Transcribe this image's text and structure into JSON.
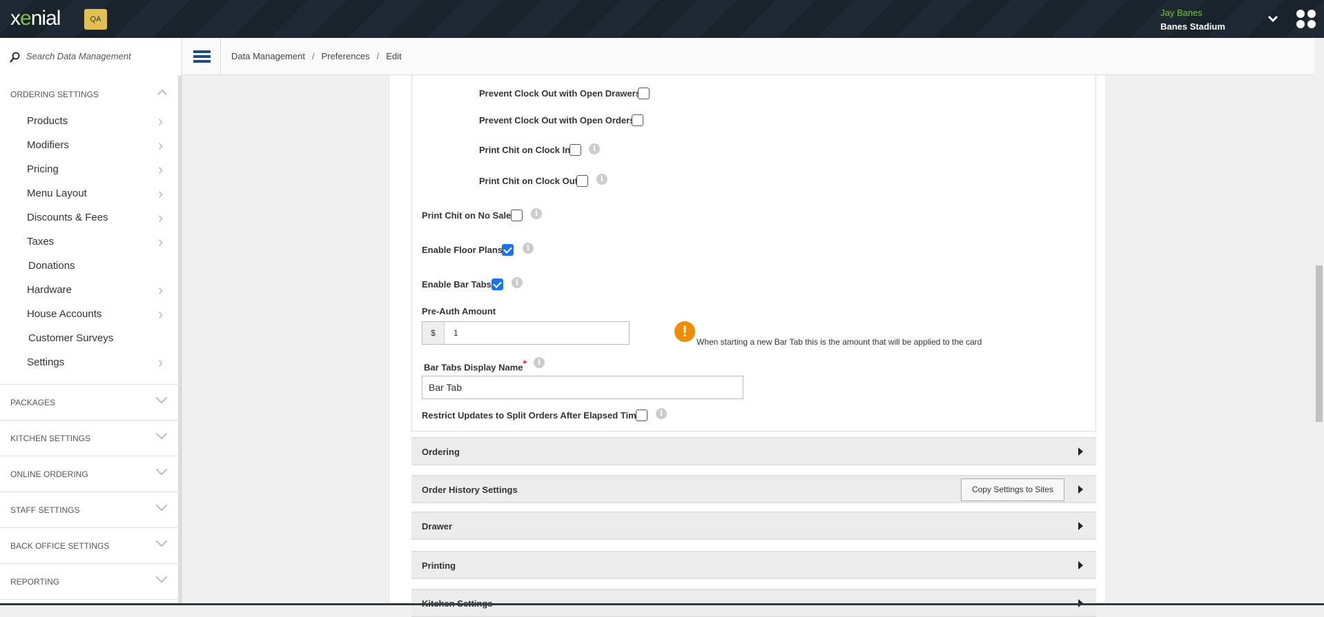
{
  "header": {
    "logo_pre": "x",
    "logo_accent": "e",
    "logo_post": "nial",
    "env_badge": "QA",
    "user_name": "Jay Banes",
    "site_name": "Banes Stadium"
  },
  "search": {
    "placeholder": "Search Data Management"
  },
  "breadcrumb": [
    "Data Management",
    "Preferences",
    "Edit"
  ],
  "sidebar": {
    "expanded_section": "ORDERING SETTINGS",
    "items": [
      {
        "label": "Products",
        "chevron": true
      },
      {
        "label": "Modifiers",
        "chevron": true
      },
      {
        "label": "Pricing",
        "chevron": true
      },
      {
        "label": "Menu Layout",
        "chevron": true
      },
      {
        "label": "Discounts & Fees",
        "chevron": true
      },
      {
        "label": "Taxes",
        "chevron": true
      },
      {
        "label": "Donations",
        "chevron": false
      },
      {
        "label": "Hardware",
        "chevron": true
      },
      {
        "label": "House Accounts",
        "chevron": true
      },
      {
        "label": "Customer Surveys",
        "chevron": false
      },
      {
        "label": "Settings",
        "chevron": true
      }
    ],
    "sections": [
      "PACKAGES",
      "KITCHEN SETTINGS",
      "ONLINE ORDERING",
      "STAFF SETTINGS",
      "BACK OFFICE SETTINGS",
      "REPORTING"
    ]
  },
  "form": {
    "prevent_drawers": {
      "label": "Prevent Clock Out with Open Drawers",
      "checked": false
    },
    "prevent_orders": {
      "label": "Prevent Clock Out with Open Orders",
      "checked": false
    },
    "chit_clock_in": {
      "label": "Print Chit on Clock In",
      "checked": false
    },
    "chit_clock_out": {
      "label": "Print Chit on Clock Out",
      "checked": false
    },
    "chit_no_sale": {
      "label": "Print Chit on No Sale",
      "checked": false
    },
    "floor_plans": {
      "label": "Enable Floor Plans",
      "checked": true
    },
    "bar_tabs": {
      "label": "Enable Bar Tabs",
      "checked": true
    },
    "preauth": {
      "label": "Pre-Auth Amount",
      "prefix": "$",
      "value": "1",
      "hint": "When starting a new Bar Tab this is the amount that will be applied to the card"
    },
    "display_name": {
      "label": "Bar Tabs Display Name",
      "required": "*",
      "value": "Bar Tab"
    },
    "restrict_split": {
      "label": "Restrict Updates to Split Orders After Elapsed Time",
      "checked": false
    },
    "info_glyph": "i",
    "warn_glyph": "!"
  },
  "sections": [
    "Ordering",
    "Order History Settings",
    "Drawer",
    "Printing",
    "Kitchen Settings"
  ],
  "copy_button": "Copy Settings to Sites"
}
